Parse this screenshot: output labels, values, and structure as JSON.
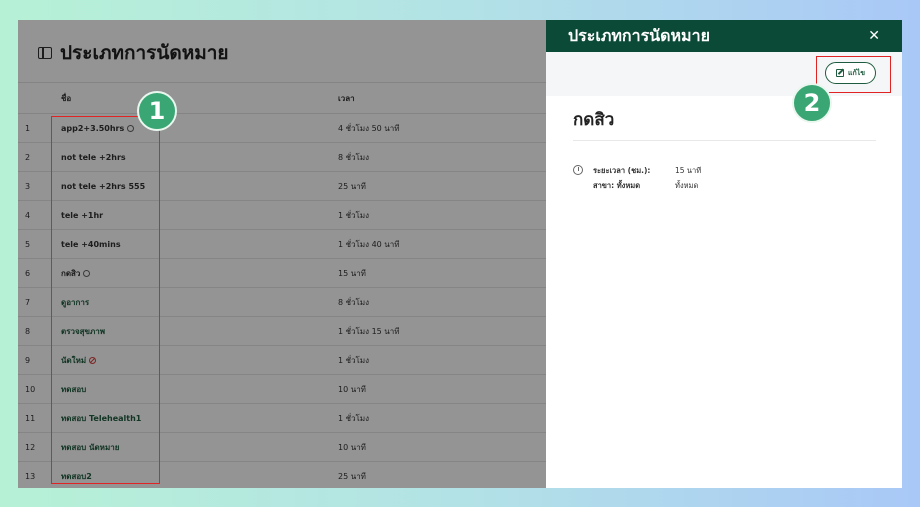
{
  "page": {
    "title": "ประเภทการนัดหมาย"
  },
  "table": {
    "headers": {
      "name": "ชื่อ",
      "duration": "เวลา"
    },
    "rows": [
      {
        "index": "1",
        "name": "app2+3.50hrs",
        "duration": "4 ชั่วโมง 50 นาที",
        "icon": "clock-icon",
        "green": false
      },
      {
        "index": "2",
        "name": "not tele +2hrs",
        "duration": "8 ชั่วโมง",
        "icon": "",
        "green": false
      },
      {
        "index": "3",
        "name": "not tele +2hrs 555",
        "duration": "25 นาที",
        "icon": "",
        "green": false
      },
      {
        "index": "4",
        "name": "tele +1hr",
        "duration": "1 ชั่วโมง",
        "icon": "",
        "green": false
      },
      {
        "index": "5",
        "name": "tele +40mins",
        "duration": "1 ชั่วโมง 40 นาที",
        "icon": "",
        "green": false
      },
      {
        "index": "6",
        "name": "กดสิว",
        "duration": "15 นาที",
        "icon": "clock-icon",
        "green": false
      },
      {
        "index": "7",
        "name": "ดูอาการ",
        "duration": "8 ชั่วโมง",
        "icon": "",
        "green": true
      },
      {
        "index": "8",
        "name": "ตรวจสุขภาพ",
        "duration": "1 ชั่วโมง 15 นาที",
        "icon": "",
        "green": true
      },
      {
        "index": "9",
        "name": "นัดใหม่",
        "duration": "1 ชั่วโมง",
        "icon": "ban-icon",
        "green": true
      },
      {
        "index": "10",
        "name": "ทดสอบ",
        "duration": "10 นาที",
        "icon": "",
        "green": true
      },
      {
        "index": "11",
        "name": "ทดสอบ Telehealth1",
        "duration": "1 ชั่วโมง",
        "icon": "",
        "green": true
      },
      {
        "index": "12",
        "name": "ทดสอบ นัดหมาย",
        "duration": "10 นาที",
        "icon": "",
        "green": true
      },
      {
        "index": "13",
        "name": "ทดสอบ2",
        "duration": "25 นาที",
        "icon": "",
        "green": true
      }
    ]
  },
  "drawer": {
    "title": "ประเภทการนัดหมาย",
    "close": "✕",
    "edit_label": "แก้ไข",
    "detail_title": "กดสิว",
    "duration_label": "ระยะเวลา (ชม.):",
    "duration_value": "15 นาที",
    "branch_label": "สาขา: ทั้งหมด",
    "branch_value": "ทั้งหมด"
  },
  "annotations": {
    "badge1": "1",
    "badge2": "2"
  },
  "colors": {
    "drawer_header": "#0b4a36",
    "accent": "#1f5c3f",
    "annotation_red": "#e02424",
    "badge_green": "#3aa673"
  }
}
